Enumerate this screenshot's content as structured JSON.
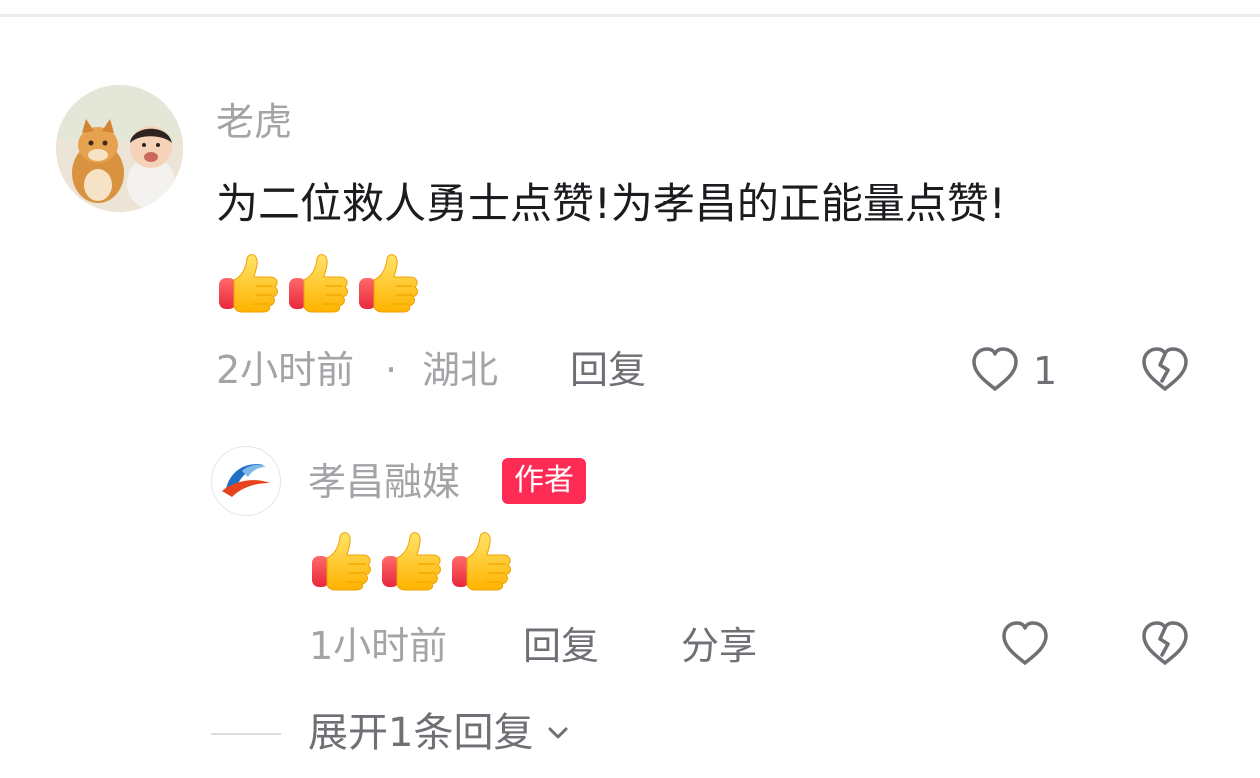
{
  "comment": {
    "username": "老虎",
    "text": "为二位救人勇士点赞!为孝昌的正能量点赞!",
    "emojis": [
      "thumbs-up",
      "thumbs-up",
      "thumbs-up"
    ],
    "time": "2小时前",
    "separator": "·",
    "location": "湖北",
    "reply_label": "回复",
    "like_count": "1"
  },
  "reply": {
    "username": "孝昌融媒",
    "badge": "作者",
    "emojis": [
      "thumbs-up",
      "thumbs-up",
      "thumbs-up"
    ],
    "time": "1小时前",
    "reply_label": "回复",
    "share_label": "分享"
  },
  "expand": {
    "label": "展开1条回复"
  },
  "colors": {
    "badge": "#fe2c55",
    "muted_text": "#a4a4a8",
    "action_text": "#6f6f75",
    "primary_text": "#1c1c20"
  }
}
